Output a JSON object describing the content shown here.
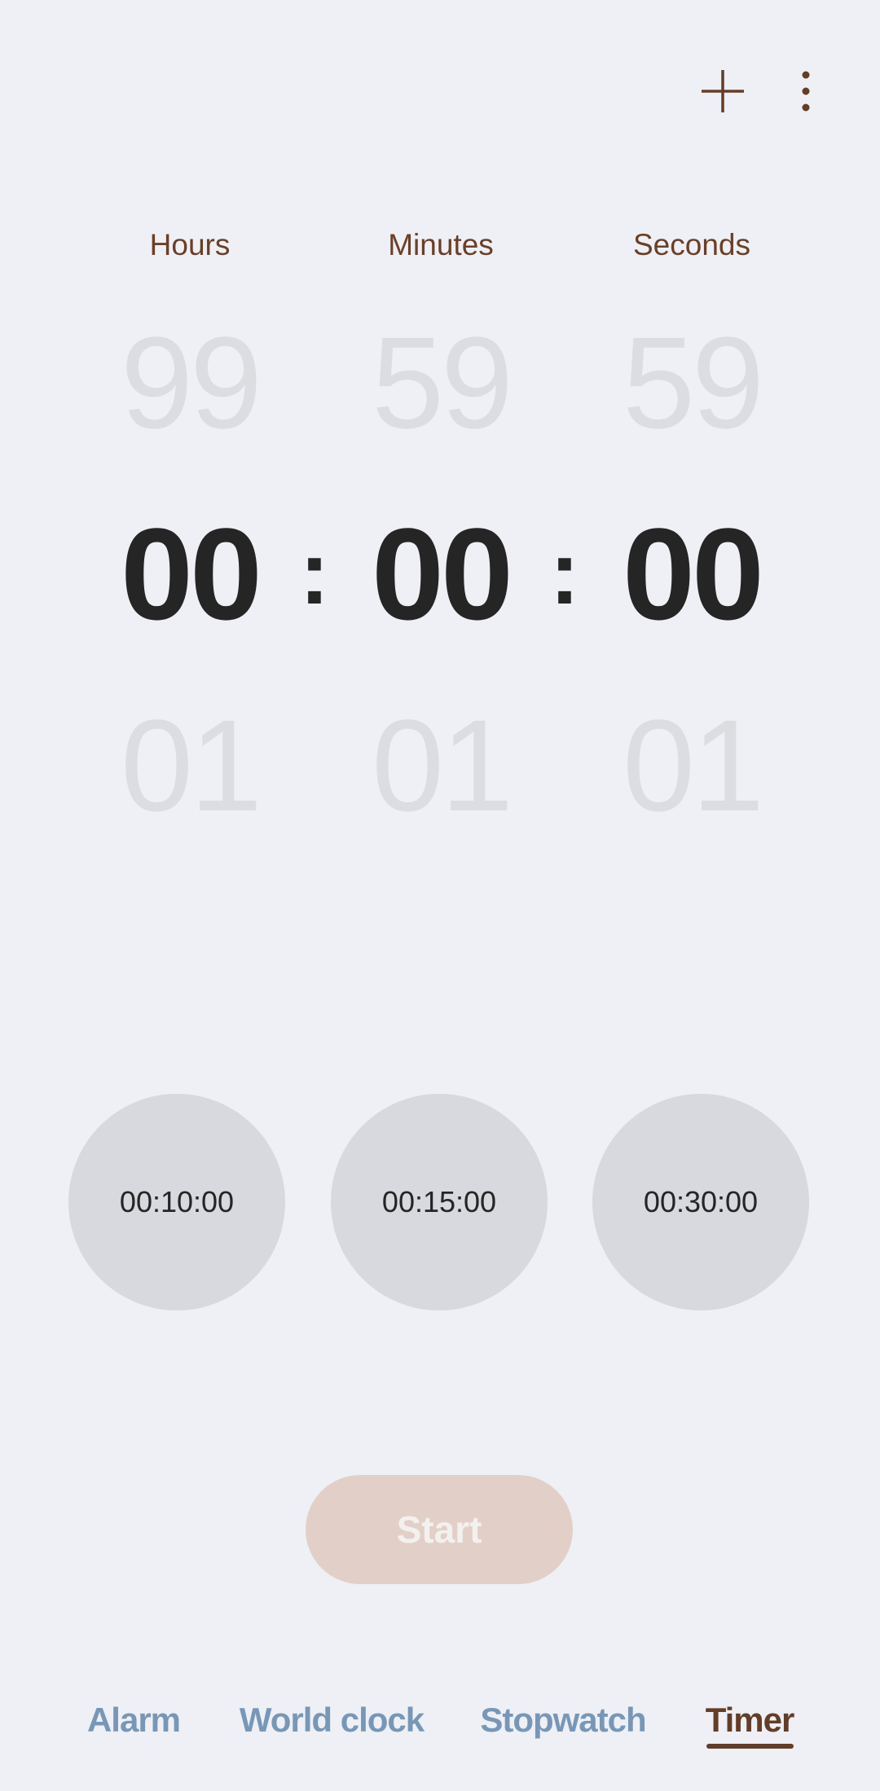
{
  "toolbar": {
    "add_icon": "plus-icon",
    "more_icon": "more-vertical-icon"
  },
  "picker": {
    "labels": [
      "Hours",
      "Minutes",
      "Seconds"
    ],
    "previous": [
      "99",
      "59",
      "59"
    ],
    "current": [
      "00",
      "00",
      "00"
    ],
    "next": [
      "01",
      "01",
      "01"
    ],
    "separator": ":"
  },
  "presets": [
    "00:10:00",
    "00:15:00",
    "00:30:00"
  ],
  "start_label": "Start",
  "tabs": [
    {
      "label": "Alarm"
    },
    {
      "label": "World clock"
    },
    {
      "label": "Stopwatch"
    },
    {
      "label": "Timer",
      "active": true
    }
  ],
  "colors": {
    "accent": "#643d26",
    "inactive_tab": "#7897b7",
    "background": "#eef0f5"
  }
}
